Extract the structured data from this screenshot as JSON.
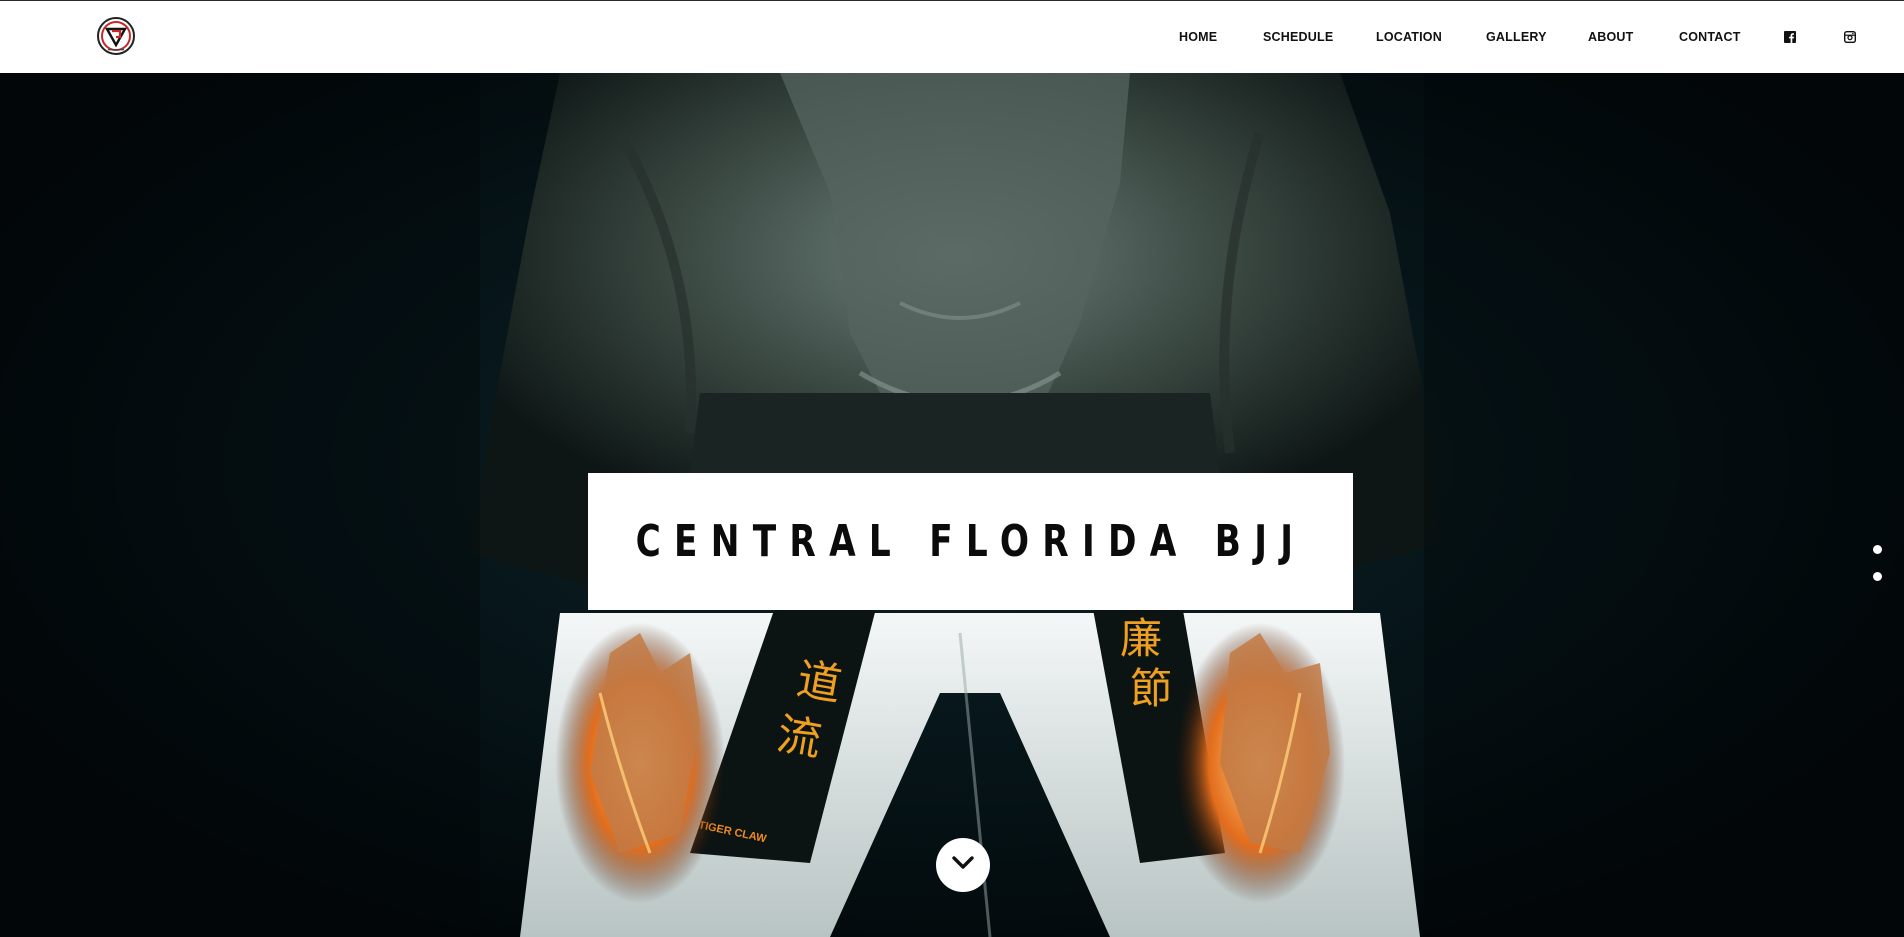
{
  "header": {
    "logo_icon": "tiger-fist-logo-icon",
    "nav": [
      {
        "label": "HOME"
      },
      {
        "label": "SCHEDULE"
      },
      {
        "label": "LOCATION"
      },
      {
        "label": "GALLERY"
      },
      {
        "label": "ABOUT"
      },
      {
        "label": "CONTACT"
      }
    ],
    "social": [
      {
        "icon": "facebook-icon"
      },
      {
        "icon": "instagram-icon"
      }
    ]
  },
  "hero": {
    "title": "CENTRAL FLORIDA BJJ",
    "slides_count": 2,
    "active_slide": 1,
    "scroll_icon": "chevron-down-icon",
    "belt_lettering": "TIGER CLAW",
    "colors": {
      "background": "#061418",
      "gi_top": "#3b4a47",
      "gi_pants": "#e8eeee",
      "belt": "#0c1413",
      "embroidery": "#f0a020",
      "flame": "#ff9a30"
    }
  }
}
